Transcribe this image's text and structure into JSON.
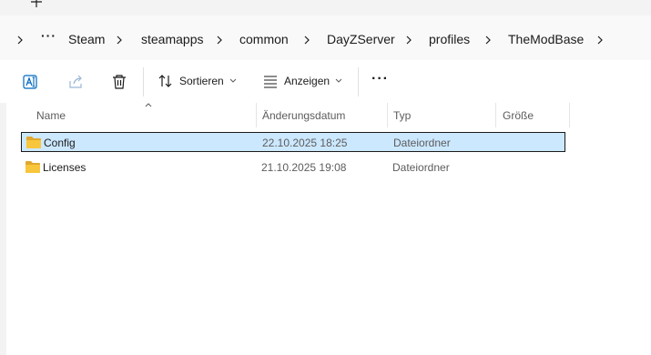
{
  "tabs": {
    "new_tab_glyph": "+"
  },
  "breadcrumb": {
    "overflow": "···",
    "items": [
      "Steam",
      "steamapps",
      "common",
      "DayZServer",
      "profiles",
      "TheModBase"
    ]
  },
  "toolbar": {
    "rename_icon": "rename-icon",
    "share_icon": "share-icon",
    "delete_icon": "delete-icon",
    "sort_label": "Sortieren",
    "view_label": "Anzeigen",
    "more_glyph": "···"
  },
  "columns": {
    "name": "Name",
    "modified": "Änderungsdatum",
    "type": "Typ",
    "size": "Größe"
  },
  "rows": [
    {
      "name": "Config",
      "modified": "22.10.2025 18:25",
      "type": "Dateiordner",
      "selected": true
    },
    {
      "name": "Licenses",
      "modified": "21.10.2025 19:08",
      "type": "Dateiordner",
      "selected": false
    }
  ],
  "colors": {
    "accent": "#0067c0",
    "selection_bg": "#cce8ff",
    "folder_yellow": "#f8c63c",
    "folder_dark": "#e0a82e"
  }
}
